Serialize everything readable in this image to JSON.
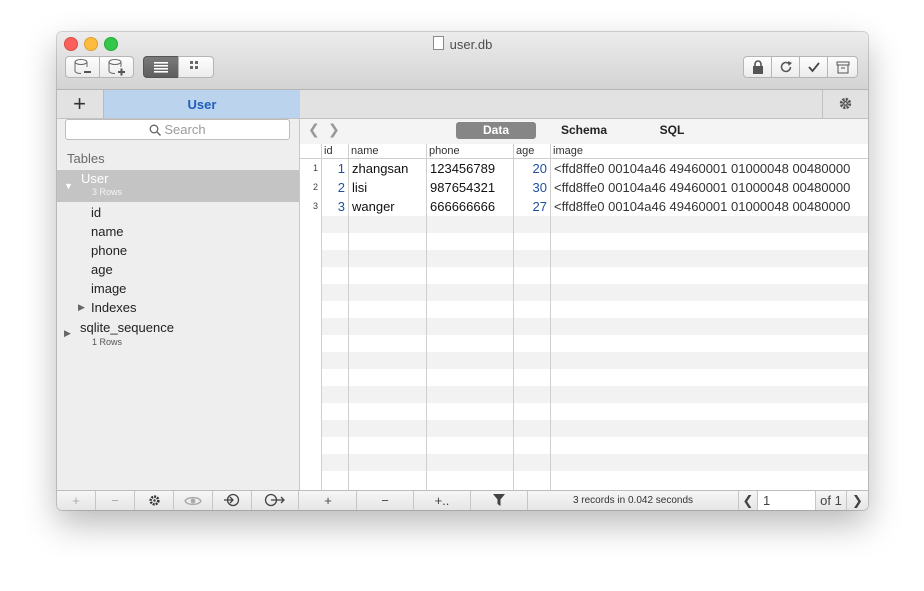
{
  "window": {
    "title": "user.db"
  },
  "sidebar": {
    "tab_label": "User",
    "search_placeholder": "Search",
    "tables_header": "Tables",
    "table_user": {
      "name": "User",
      "rows": "3 Rows"
    },
    "columns": [
      "id",
      "name",
      "phone",
      "age",
      "image"
    ],
    "indexes_label": "Indexes",
    "table_sequence": {
      "name": "sqlite_sequence",
      "rows": "1 Rows"
    }
  },
  "view_tabs": [
    "Data",
    "Schema",
    "SQL"
  ],
  "table": {
    "headers": [
      "id",
      "name",
      "phone",
      "age",
      "image"
    ],
    "rows": [
      {
        "num": "1",
        "id": "1",
        "name": "zhangsan",
        "phone": "123456789",
        "age": "20",
        "image": "<ffd8ffe0 00104a46 49460001 01000048 00480000"
      },
      {
        "num": "2",
        "id": "2",
        "name": "lisi",
        "phone": "987654321",
        "age": "30",
        "image": "<ffd8ffe0 00104a46 49460001 01000048 00480000"
      },
      {
        "num": "3",
        "id": "3",
        "name": "wanger",
        "phone": "666666666",
        "age": "27",
        "image": "<ffd8ffe0 00104a46 49460001 01000048 00480000"
      }
    ]
  },
  "status": {
    "records": "3 records in 0.042 seconds",
    "page": "1",
    "page_of": "of 1"
  },
  "colors": {
    "accent": "#1f5fbd",
    "selected_tab": "#bcd3ee",
    "selection": "#c4c4c4"
  }
}
